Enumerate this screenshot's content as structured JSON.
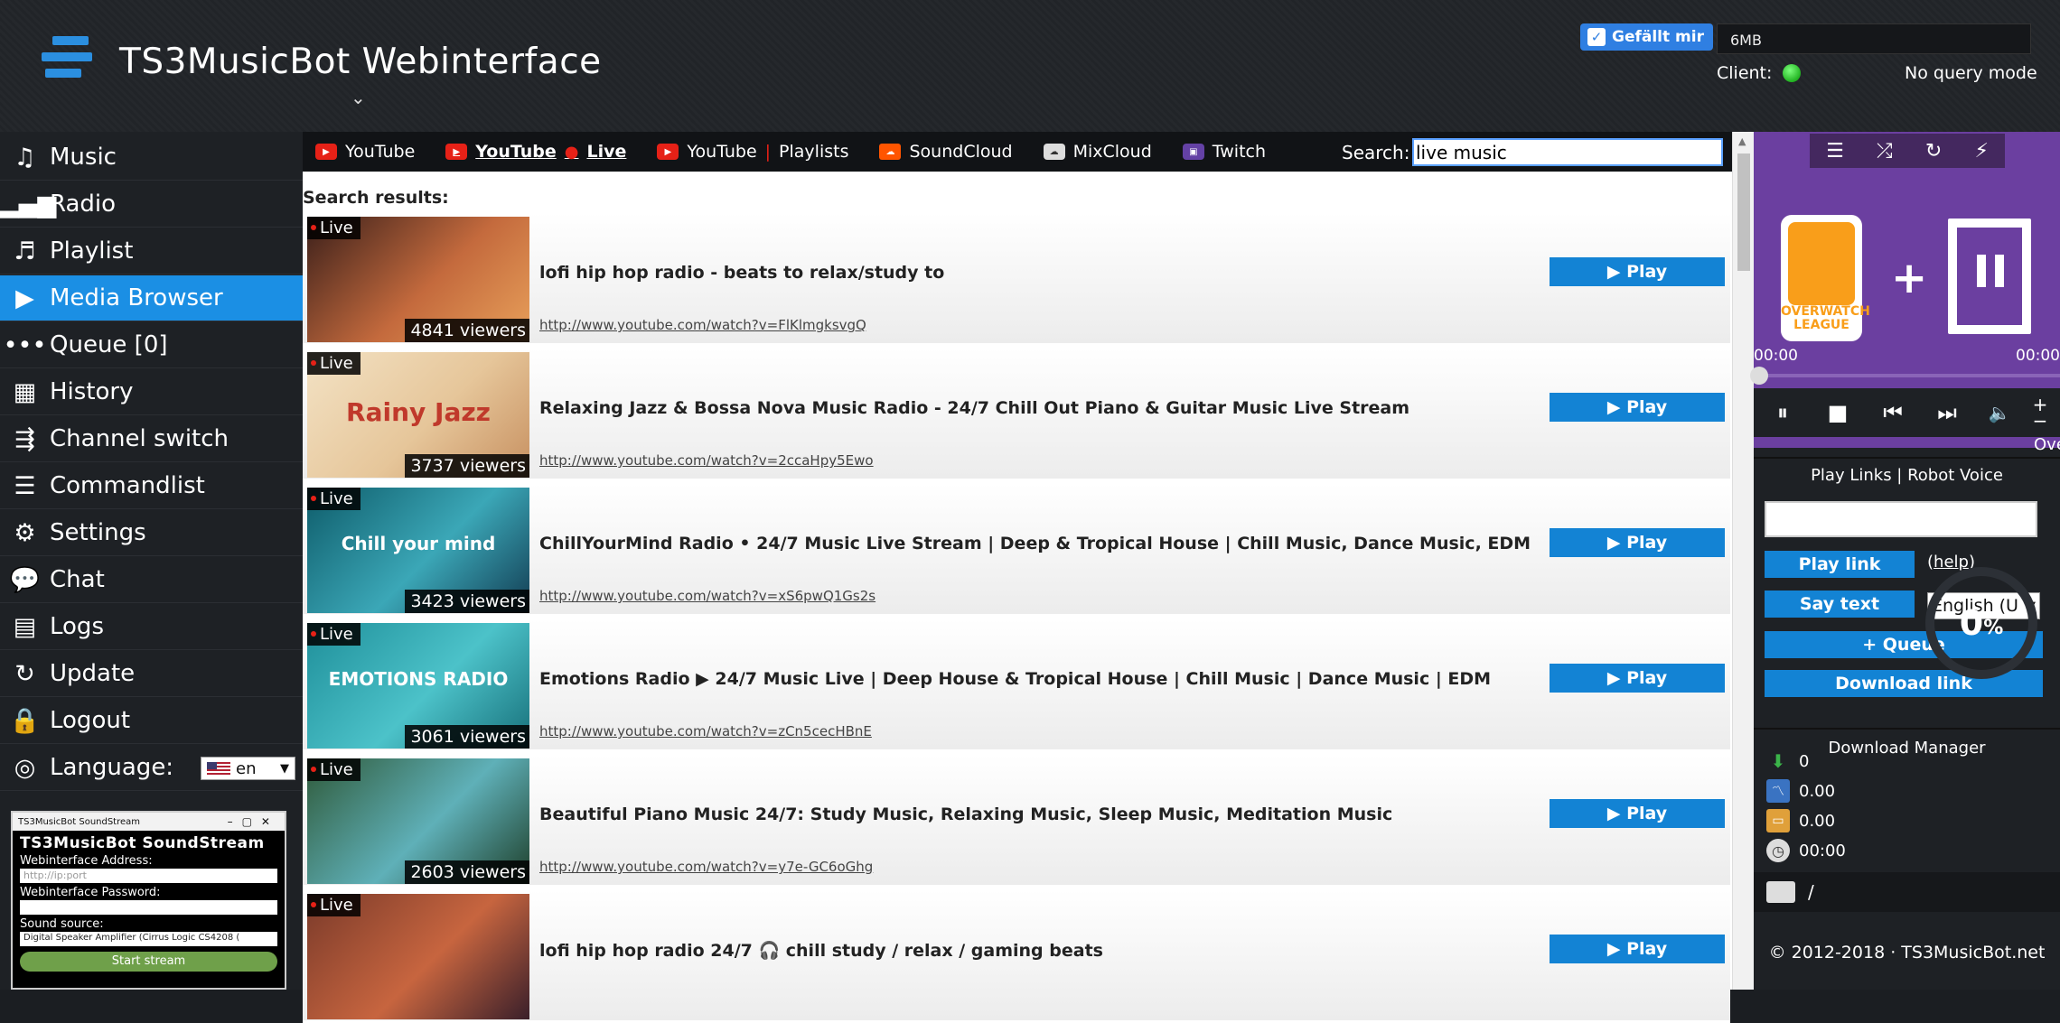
{
  "header": {
    "title": "TS3MusicBot Webinterface",
    "caret": "⌄",
    "like_label": "Gefällt mir",
    "memory": "6MB",
    "client_label": "Client:",
    "query_mode": "No query mode",
    "status_color": "#22b322"
  },
  "sidebar": {
    "items": [
      {
        "label": "Music",
        "icon": "♫"
      },
      {
        "label": "Radio",
        "icon": "▂▄▆"
      },
      {
        "label": "Playlist",
        "icon": "♬"
      },
      {
        "label": "Media Browser",
        "icon": "▶"
      },
      {
        "label": "Queue [0]",
        "icon": "•••"
      },
      {
        "label": "History",
        "icon": "▦"
      },
      {
        "label": "Channel switch",
        "icon": "⇶"
      },
      {
        "label": "Commandlist",
        "icon": "☰"
      },
      {
        "label": "Settings",
        "icon": "⚙"
      },
      {
        "label": "Chat",
        "icon": "💬"
      },
      {
        "label": "Logs",
        "icon": "▤"
      },
      {
        "label": "Update",
        "icon": "↻"
      },
      {
        "label": "Logout",
        "icon": "🔒"
      },
      {
        "label": "Language:",
        "icon": "◎"
      }
    ],
    "active_index": 3,
    "language_value": "en",
    "soundstream": {
      "window_title": "TS3MusicBot SoundStream",
      "title": "TS3MusicBot SoundStream",
      "address_label": "Webinterface Address:",
      "address_placeholder": "http://ip:port",
      "password_label": "Webinterface Password:",
      "source_label": "Sound source:",
      "source_value": "Digital Speaker Amplifier (Cirrus Logic CS4208 (",
      "start_label": "Start stream"
    }
  },
  "services": {
    "tabs": [
      {
        "label": "YouTube",
        "icon": "youtube-icon",
        "kind": "yt"
      },
      {
        "label": "YouTube",
        "suffix": "Live",
        "sep": "●",
        "icon": "youtube-icon",
        "kind": "yt",
        "active": true
      },
      {
        "label": "YouTube",
        "suffix": "Playlists",
        "sep": "|",
        "icon": "youtube-icon",
        "kind": "yt"
      },
      {
        "label": "SoundCloud",
        "icon": "soundcloud-icon",
        "kind": "sc"
      },
      {
        "label": "MixCloud",
        "icon": "mixcloud-icon",
        "kind": "mc"
      },
      {
        "label": "Twitch",
        "icon": "twitch-icon",
        "kind": "tw"
      }
    ],
    "search_label": "Search:",
    "search_value": "live music"
  },
  "results": {
    "label": "Search results:",
    "live_label": "Live",
    "play_label": "▶ Play",
    "items": [
      {
        "title": "lofi hip hop radio - beats to relax/study to",
        "url": "http://www.youtube.com/watch?v=FlKlmgksvgQ",
        "viewers": "4841 viewers",
        "caption": "",
        "colors": [
          "#3a1f1a",
          "#c46a3d",
          "#e8a05a"
        ]
      },
      {
        "title": "Relaxing Jazz & Bossa Nova Music Radio - 24/7 Chill Out Piano & Guitar Music Live Stream",
        "url": "http://www.youtube.com/watch?v=2ccaHpy5Ewo",
        "viewers": "3737 viewers",
        "caption": "Rainy Jazz",
        "colors": [
          "#f3e2c4",
          "#e6c69a",
          "#c79060"
        ]
      },
      {
        "title": "ChillYourMind Radio • 24/7 Music Live Stream | Deep & Tropical House | Chill Music, Dance Music, EDM",
        "url": "http://www.youtube.com/watch?v=xS6pwQ1Gs2s",
        "viewers": "3423 viewers",
        "caption": "Chill your mind",
        "colors": [
          "#0e5c6a",
          "#3ba7b7",
          "#123c52"
        ]
      },
      {
        "title": "Emotions Radio ▶ 24/7 Music Live | Deep House & Tropical House | Chill Music | Dance Music | EDM",
        "url": "http://www.youtube.com/watch?v=zCn5cecHBnE",
        "viewers": "3061 viewers",
        "caption": "EMOTIONS RADIO",
        "colors": [
          "#1f8f9a",
          "#4cc2c9",
          "#17707a"
        ]
      },
      {
        "title": "Beautiful Piano Music 24/7: Study Music, Relaxing Music, Sleep Music, Meditation Music",
        "url": "http://www.youtube.com/watch?v=y7e-GC6oGhg",
        "viewers": "2603 viewers",
        "caption": "",
        "colors": [
          "#2f5a3a",
          "#5fb0b8",
          "#1e3f2a"
        ]
      },
      {
        "title": "lofi hip hop radio 24/7 🎧 chill study / relax / gaming beats",
        "url": "",
        "viewers": "",
        "caption": "",
        "colors": [
          "#7a3a2a",
          "#c7653f",
          "#3a1f2a"
        ]
      }
    ]
  },
  "player": {
    "time_left": "00:00",
    "time_right": "00:00",
    "marquee": "Ove",
    "cover_text": "OVERWATCH LEAGUE",
    "plus": "+",
    "toolbar_icons": [
      "list-icon",
      "shuffle-icon",
      "repeat-icon",
      "bolt-icon"
    ],
    "volume_plus": "+",
    "volume_minus": "−"
  },
  "links": {
    "heading": "Play Links | Robot Voice",
    "play_link_label": "Play link",
    "help_label": "help",
    "say_text_label": "Say text",
    "voice_value": "English (U",
    "queue_label": "+ Queue",
    "download_label": "Download link"
  },
  "download_manager": {
    "heading": "Download Manager",
    "count": "0",
    "speed": "0.00",
    "size": "0.00",
    "time": "00:00",
    "percent": "0",
    "percent_sign": "%",
    "path": "/"
  },
  "footer": {
    "copyright": "© 2012-2018 · TS3MusicBot.net"
  }
}
